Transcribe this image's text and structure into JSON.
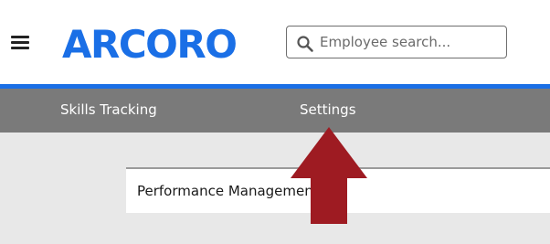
{
  "header": {
    "logo_text": "ARCORO",
    "search": {
      "placeholder": "Employee search..."
    }
  },
  "nav": {
    "items": [
      {
        "label": "Skills Tracking"
      },
      {
        "label": "Settings"
      }
    ]
  },
  "main": {
    "card_title": "Performance Management"
  },
  "icons": {
    "menu": "hamburger-menu-icon",
    "search": "search-icon",
    "annotation": "up-arrow-icon"
  },
  "colors": {
    "brand_blue": "#1a6fe6",
    "accent_line": "#1a6fe6",
    "nav_background": "#7a7a7a",
    "arrow": "#9e1b22",
    "page_background": "#e8e8e8"
  }
}
